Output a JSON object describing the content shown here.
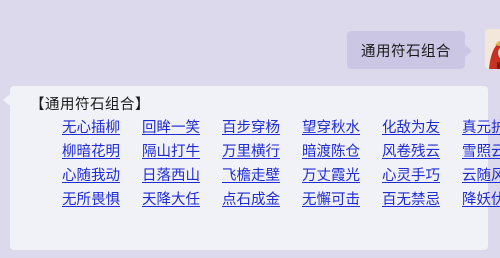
{
  "user_message": {
    "text": "通用符石组合"
  },
  "reply": {
    "title": "【通用符石组合】",
    "combos": [
      "无心插柳",
      "回眸一笑",
      "百步穿杨",
      "望穿秋水",
      "化敌为友",
      "真元护体",
      "柳暗花明",
      "隔山打牛",
      "万里横行",
      "暗渡陈仓",
      "风卷残云",
      "雪照云光",
      "心随我动",
      "日落西山",
      "飞檐走壁",
      "万丈霞光",
      "心灵手巧",
      "云随风舞",
      "无所畏惧",
      "天降大任",
      "点石成金",
      "无懈可击",
      "百无禁忌",
      "降妖伏魔"
    ]
  },
  "colors": {
    "background": "#dcd9ec",
    "user_bubble": "#cbc6e4",
    "reply_bubble": "#f1f1f8",
    "link": "#1f2bd6"
  }
}
